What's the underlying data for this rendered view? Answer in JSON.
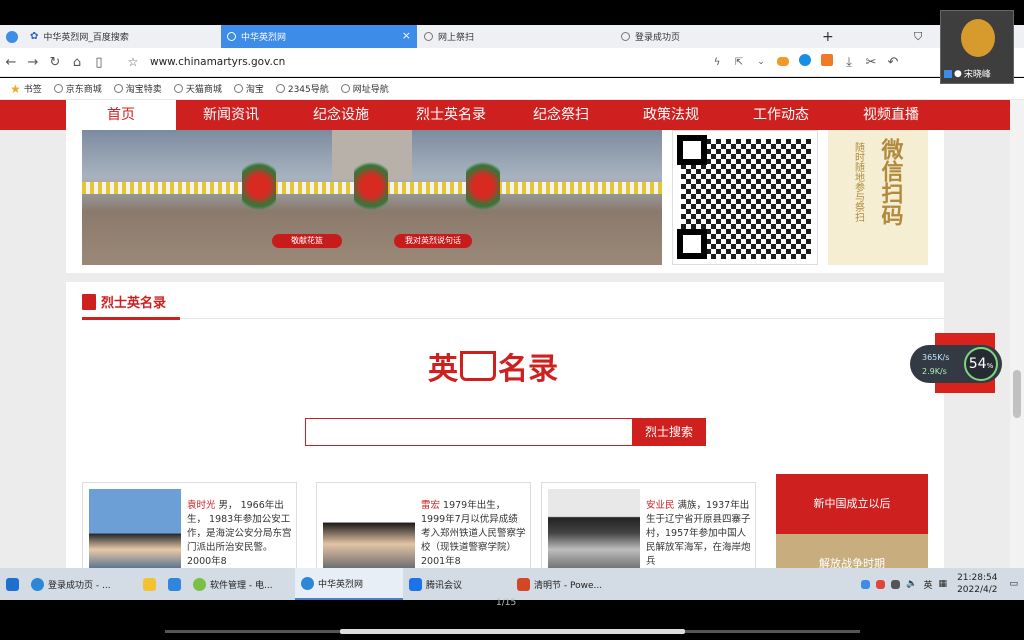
{
  "tabs": [
    {
      "label": "中华英烈网_百度搜索",
      "active": false
    },
    {
      "label": "中华英烈网",
      "active": true
    },
    {
      "label": "网上祭扫",
      "active": false
    },
    {
      "label": "登录成功页",
      "active": false
    }
  ],
  "address": {
    "url": "www.chinamartyrs.gov.cn"
  },
  "bookmarks": {
    "label": "书签",
    "items": [
      "京东商城",
      "淘宝特卖",
      "天猫商城",
      "淘宝",
      "2345导航",
      "网址导航"
    ]
  },
  "nav": {
    "items": [
      "首页",
      "新闻资讯",
      "纪念设施",
      "烈士英名录",
      "纪念祭扫",
      "政策法规",
      "工作动态",
      "视频直播"
    ],
    "active": 0
  },
  "banner": {
    "btn1": "敬献花篮",
    "btn2": "我对英烈说句话"
  },
  "wechat": {
    "big": "微信扫码",
    "small": "随时随地参与祭扫"
  },
  "section": {
    "title": "烈士英名录"
  },
  "logo": {
    "left": "英",
    "right": "名录"
  },
  "search": {
    "button": "烈士搜索",
    "placeholder": ""
  },
  "heroes": [
    {
      "name": "袁时光",
      "text": "男，  1966年出生， 1983年参加公安工作，是海淀公安分局东宫门派出所治安民警。2000年8"
    },
    {
      "name": "雷宏",
      "text": "1979年出生，1999年7月以优异成绩考入郑州铁道人民警察学校（现铁道警察学院）  2001年8"
    },
    {
      "name": "安业民",
      "text": "满族，1937年出生于辽宁省开原县四寨子村，1957年参加中国人民解放军海军，在海岸炮兵"
    }
  ],
  "eras": [
    "新中国成立以后",
    "解放战争时期"
  ],
  "speed": {
    "up": "365K/s",
    "down": "2.9K/s",
    "percent": "54",
    "unit": "%"
  },
  "taskbar": {
    "items": [
      "登录成功页 - ...",
      "软件管理 - 电...",
      "中华英烈网",
      "腾讯会议",
      "清明节 - Powe..."
    ],
    "lang": "英",
    "time": "21:28:54",
    "date": "2022/4/2"
  },
  "meeting": {
    "page": "1/15",
    "user": "宋晓峰"
  },
  "colors": {
    "brand": "#cf2020",
    "tab_active": "#3c8ce8"
  }
}
